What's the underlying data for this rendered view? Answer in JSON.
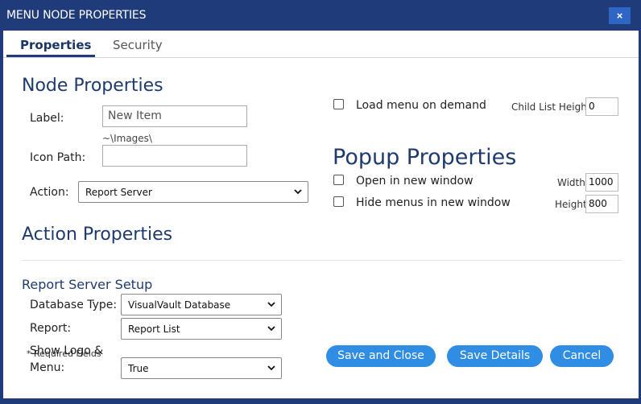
{
  "window": {
    "title": "MENU NODE PROPERTIES",
    "close_label": "×"
  },
  "tabs": [
    {
      "label": "Properties",
      "active": true
    },
    {
      "label": "Security",
      "active": false
    }
  ],
  "node_properties": {
    "heading": "Node Properties",
    "label_label": "Label:",
    "label_value": "New Item",
    "icon_path_hint": "~\\Images\\",
    "icon_path_label": "Icon Path:",
    "icon_path_value": "",
    "action_label": "Action:",
    "action_value": "Report Server"
  },
  "load_on_demand": {
    "label": "Load menu on demand",
    "checked": false
  },
  "child_list_height": {
    "label": "Child List Height:",
    "value": "0"
  },
  "popup_properties": {
    "heading": "Popup Properties",
    "open_new_window": {
      "label": "Open in new window",
      "checked": false
    },
    "hide_menus": {
      "label": "Hide menus in new window",
      "checked": false
    },
    "width_label": "Width",
    "width_value": "1000",
    "height_label": "Height",
    "height_value": "800"
  },
  "action_properties": {
    "heading": "Action Properties"
  },
  "report_server_setup": {
    "heading": "Report Server Setup",
    "database_type_label": "Database Type:",
    "database_type_value": "VisualVault Database",
    "report_label": "Report:",
    "report_value": "Report List",
    "show_logo_label_line1": "Show Logo &",
    "show_logo_label_line2": "Menu:",
    "show_logo_value": "True"
  },
  "footnote": "* Required Fields",
  "buttons": {
    "save_close": "Save and Close",
    "save_details": "Save Details",
    "cancel": "Cancel"
  },
  "colors": {
    "frame": "#1f3b7a",
    "heading": "#1f3b6e",
    "button": "#2f8de4",
    "close_button": "#2f66c6"
  }
}
